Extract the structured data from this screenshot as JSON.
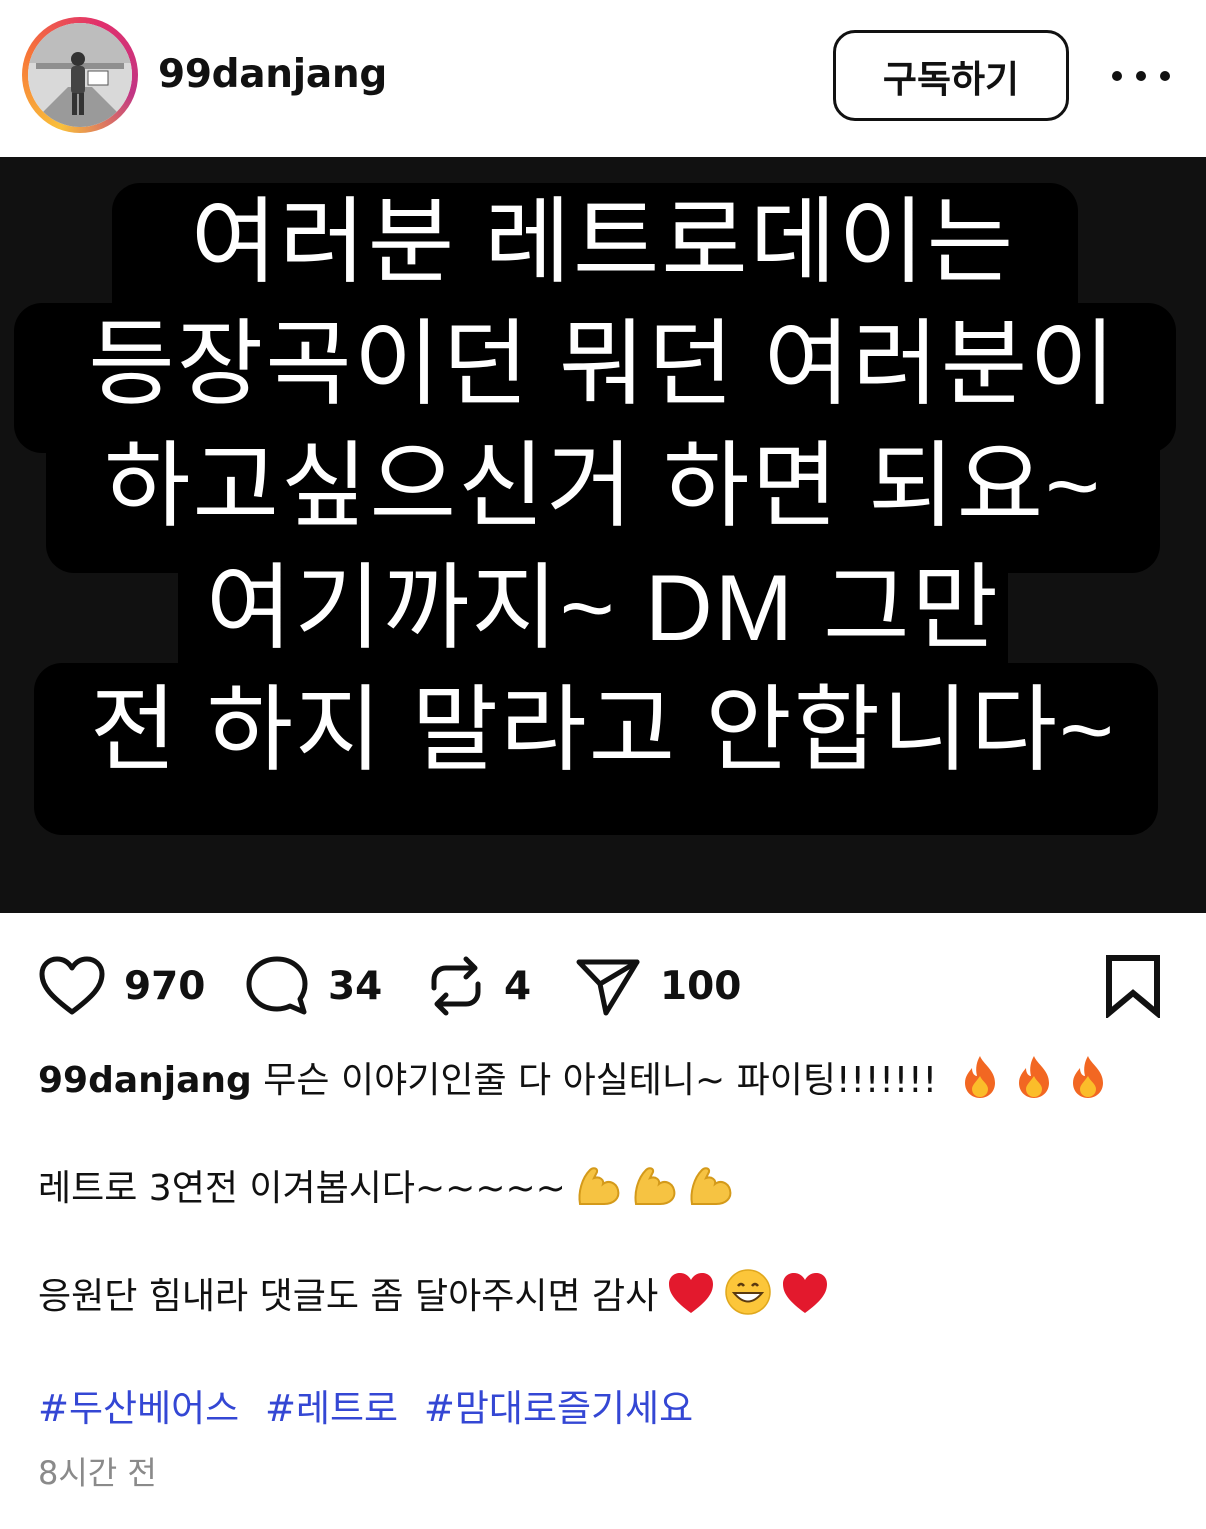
{
  "header": {
    "username": "99danjang",
    "subscribe_label": "구독하기",
    "more_icon": "more-horizontal-icon"
  },
  "post_image": {
    "lines": [
      "여러분 레트로데이는",
      "등장곡이던 뭐던 여러분이",
      "하고싶으신거 하면 되요~",
      "여기까지~ DM 그만",
      "전 하지 말라고 안합니다~"
    ],
    "background_color": "#111111",
    "text_color": "#ffffff"
  },
  "actions": {
    "likes": "970",
    "comments": "34",
    "reposts": "4",
    "shares": "100",
    "icons": [
      "heart-icon",
      "comment-icon",
      "repost-icon",
      "share-icon",
      "bookmark-icon"
    ]
  },
  "caption": {
    "username": "99danjang",
    "line1": "무슨 이야기인줄 다 아실테니~ 파이팅!!!!!!!",
    "line1_emoji": [
      "fire",
      "fire",
      "fire"
    ],
    "line2": "레트로 3연전 이겨봅시다~~~~~",
    "line2_emoji": [
      "flexed-biceps",
      "flexed-biceps",
      "flexed-biceps"
    ],
    "line3": "응원단 힘내라 댓글도 좀 달아주시면 감사",
    "line3_emoji": [
      "red-heart",
      "grinning-face",
      "red-heart"
    ]
  },
  "hashtags": [
    "#두산베어스",
    "#레트로",
    "#맘대로즐기세요"
  ],
  "time": "8시간 전",
  "colors": {
    "hashtag": "#3447d4",
    "muted": "#8a8a8a"
  }
}
